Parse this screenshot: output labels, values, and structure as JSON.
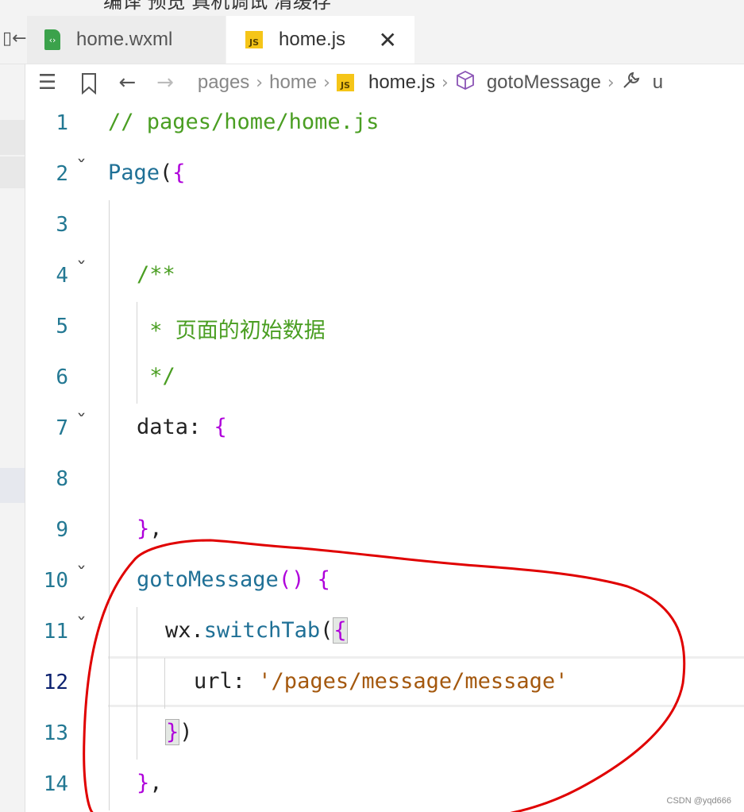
{
  "top_strip": {
    "text": "编译  预览  真机调试  清缓存"
  },
  "tabs": [
    {
      "label": "home.wxml",
      "icon": "wxml-file-icon",
      "active": false
    },
    {
      "label": "home.js",
      "icon": "js-file-icon",
      "active": true
    }
  ],
  "tab_close": "✕",
  "breadcrumb": {
    "items": [
      "pages",
      "home",
      "home.js",
      "gotoMessage",
      "u"
    ],
    "js_badge": "JS"
  },
  "editor": {
    "lines": [
      {
        "n": "1",
        "tokens": [
          {
            "t": "// pages/home/home.js",
            "c": "comment"
          }
        ]
      },
      {
        "n": "2",
        "fold": true,
        "tokens": [
          {
            "t": "Page",
            "c": "func"
          },
          {
            "t": "(",
            "c": "plain"
          },
          {
            "t": "{",
            "c": "brace"
          }
        ]
      },
      {
        "n": "3",
        "tokens": []
      },
      {
        "n": "4",
        "fold": true,
        "indent": 1,
        "tokens": [
          {
            "t": "/**",
            "c": "comment"
          }
        ]
      },
      {
        "n": "5",
        "indent": 1,
        "tokens": [
          {
            "t": " * 页面的初始数据",
            "c": "comment"
          }
        ]
      },
      {
        "n": "6",
        "indent": 1,
        "tokens": [
          {
            "t": " */",
            "c": "comment"
          }
        ]
      },
      {
        "n": "7",
        "fold": true,
        "indent": 1,
        "tokens": [
          {
            "t": "data",
            "c": "plain"
          },
          {
            "t": ": ",
            "c": "plain"
          },
          {
            "t": "{",
            "c": "brace"
          }
        ]
      },
      {
        "n": "8",
        "tokens": []
      },
      {
        "n": "9",
        "indent": 1,
        "tokens": [
          {
            "t": "}",
            "c": "brace"
          },
          {
            "t": ",",
            "c": "plain"
          }
        ]
      },
      {
        "n": "10",
        "fold": true,
        "indent": 1,
        "tokens": [
          {
            "t": "gotoMessage",
            "c": "func"
          },
          {
            "t": "() ",
            "c": "brace"
          },
          {
            "t": "{",
            "c": "brace"
          }
        ]
      },
      {
        "n": "11",
        "fold": true,
        "indent": 2,
        "tokens": [
          {
            "t": "wx",
            "c": "plain"
          },
          {
            "t": ".",
            "c": "plain"
          },
          {
            "t": "switchTab",
            "c": "func"
          },
          {
            "t": "(",
            "c": "plain"
          },
          {
            "t": "{",
            "c": "bracebox"
          }
        ]
      },
      {
        "n": "12",
        "active": true,
        "indent": 3,
        "tokens": [
          {
            "t": "url",
            "c": "plain"
          },
          {
            "t": ": ",
            "c": "plain"
          },
          {
            "t": "'/pages/message/message'",
            "c": "str"
          }
        ]
      },
      {
        "n": "13",
        "indent": 2,
        "tokens": [
          {
            "t": "}",
            "c": "bracebox"
          },
          {
            "t": ")",
            "c": "plain"
          }
        ]
      },
      {
        "n": "14",
        "indent": 1,
        "tokens": [
          {
            "t": "}",
            "c": "brace"
          },
          {
            "t": ",",
            "c": "plain"
          }
        ]
      }
    ]
  },
  "watermark": "CSDN @yqd666",
  "colors": {
    "comment": "#4a9e22",
    "function": "#1f7096",
    "brace": "#af00db",
    "string": "#a4580e",
    "line_number": "#237893",
    "annotation": "#e00000"
  }
}
